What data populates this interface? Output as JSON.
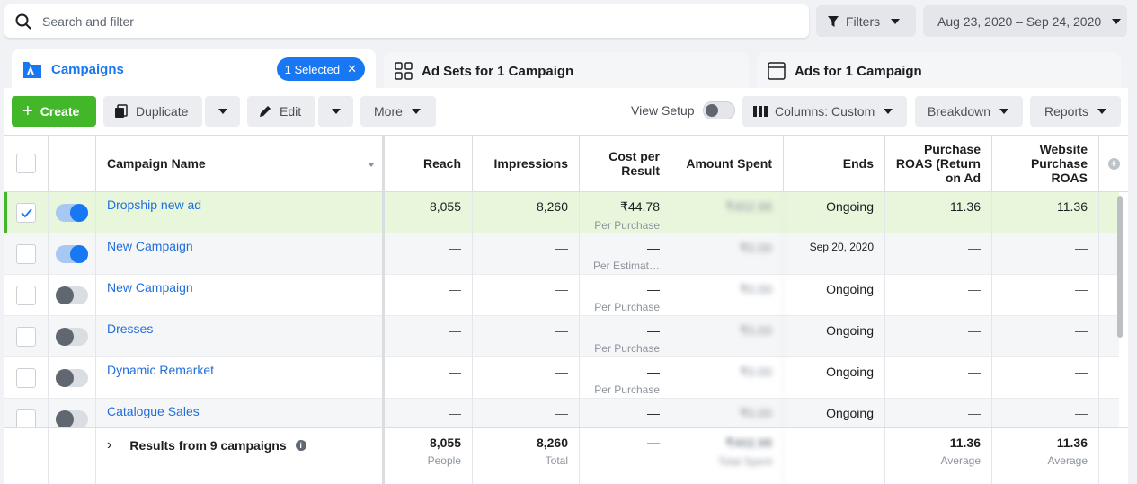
{
  "search": {
    "placeholder": "Search and filter"
  },
  "topbar": {
    "filters_label": "Filters",
    "date_range": "Aug 23, 2020 – Sep 24, 2020"
  },
  "tabs": [
    {
      "label": "Campaigns",
      "selected_badge": "1 Selected"
    },
    {
      "label": "Ad Sets for 1 Campaign"
    },
    {
      "label": "Ads for 1 Campaign"
    }
  ],
  "toolbar": {
    "create_label": "Create",
    "duplicate_label": "Duplicate",
    "edit_label": "Edit",
    "more_label": "More",
    "view_setup_label": "View Setup",
    "columns_label": "Columns: Custom",
    "breakdown_label": "Breakdown",
    "reports_label": "Reports"
  },
  "columns": {
    "name": "Campaign Name",
    "reach": "Reach",
    "impressions": "Impressions",
    "cost_per_result": "Cost per Result",
    "amount_spent": "Amount Spent",
    "ends": "Ends",
    "purchase_roas": "Purchase ROAS (Return on Ad",
    "website_purchase_roas": "Website Purchase ROAS"
  },
  "rows": [
    {
      "name": "Dropship new ad",
      "active": true,
      "checked": true,
      "reach": "8,055",
      "impressions": "8,260",
      "cost": "₹44.78",
      "cost_sub": "Per Purchase",
      "spent": "₹402.98",
      "ends": "Ongoing",
      "proas": "11.36",
      "wproas": "11.36"
    },
    {
      "name": "New Campaign",
      "active": true,
      "checked": false,
      "reach": "—",
      "impressions": "—",
      "cost": "—",
      "cost_sub": "Per Estimat…",
      "spent": "₹0.00",
      "ends": "Sep 20, 2020",
      "proas": "—",
      "wproas": "—"
    },
    {
      "name": "New Campaign",
      "active": false,
      "checked": false,
      "reach": "—",
      "impressions": "—",
      "cost": "—",
      "cost_sub": "Per Purchase",
      "spent": "₹0.00",
      "ends": "Ongoing",
      "proas": "—",
      "wproas": "—"
    },
    {
      "name": "Dresses",
      "active": false,
      "checked": false,
      "reach": "—",
      "impressions": "—",
      "cost": "—",
      "cost_sub": "Per Purchase",
      "spent": "₹0.00",
      "ends": "Ongoing",
      "proas": "—",
      "wproas": "—"
    },
    {
      "name": "Dynamic Remarket",
      "active": false,
      "checked": false,
      "reach": "—",
      "impressions": "—",
      "cost": "—",
      "cost_sub": "Per Purchase",
      "spent": "₹0.00",
      "ends": "Ongoing",
      "proas": "—",
      "wproas": "—"
    },
    {
      "name": "Catalogue Sales",
      "active": false,
      "checked": false,
      "reach": "—",
      "impressions": "—",
      "cost": "—",
      "cost_sub": "Per Purchase",
      "spent": "₹0.00",
      "ends": "Ongoing",
      "proas": "—",
      "wproas": "—"
    }
  ],
  "footer": {
    "results_label": "Results from 9 campaigns",
    "reach": "8,055",
    "reach_sub": "People",
    "impressions": "8,260",
    "impressions_sub": "Total",
    "cost": "—",
    "spent": "₹402.98",
    "spent_sub": "Total Spent",
    "proas": "11.36",
    "proas_sub": "Average",
    "wproas": "11.36",
    "wproas_sub": "Average"
  },
  "colors": {
    "accent": "#1877f2",
    "create_green": "#42b72a",
    "selected_row": "#e8f6dc"
  }
}
